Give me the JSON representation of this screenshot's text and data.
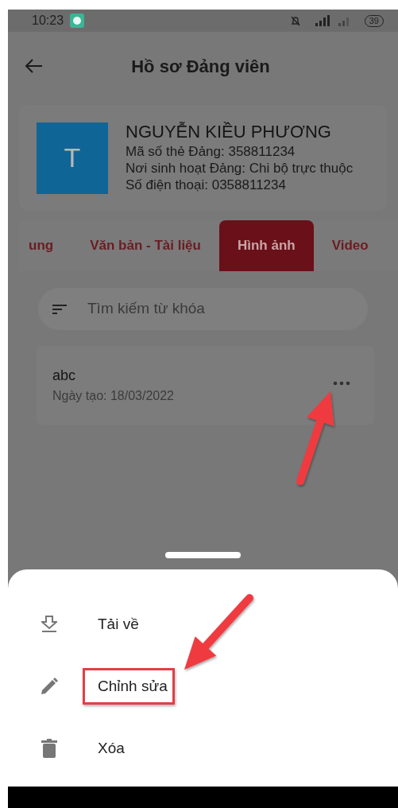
{
  "status_bar": {
    "time": "10:23",
    "battery": "39"
  },
  "app_bar": {
    "title": "Hồ sơ Đảng viên"
  },
  "profile": {
    "avatar_letter": "T",
    "name": "NGUYỄN KIỀU PHƯƠNG",
    "lines": [
      "Mã số thẻ Đảng: 358811234",
      "Nơi sinh hoạt Đảng: Chi bộ trực thuộc",
      "Số điện thoại: 0358811234"
    ]
  },
  "tabs": [
    {
      "label": "ung",
      "selected": false
    },
    {
      "label": "Văn bản - Tài liệu",
      "selected": false
    },
    {
      "label": "Hình ảnh",
      "selected": true
    },
    {
      "label": "Video",
      "selected": false
    }
  ],
  "search": {
    "placeholder": "Tìm kiếm từ khóa"
  },
  "items": [
    {
      "title": "abc",
      "date": "Ngày tạo: 18/03/2022"
    }
  ],
  "sheet": {
    "actions": [
      {
        "kind": "download",
        "label": "Tải về",
        "highlighted": false
      },
      {
        "kind": "edit",
        "label": "Chỉnh sửa",
        "highlighted": true
      },
      {
        "kind": "delete",
        "label": "Xóa",
        "highlighted": false
      }
    ]
  },
  "annotations": [
    {
      "kind": "arrow"
    },
    {
      "kind": "arrow"
    }
  ]
}
